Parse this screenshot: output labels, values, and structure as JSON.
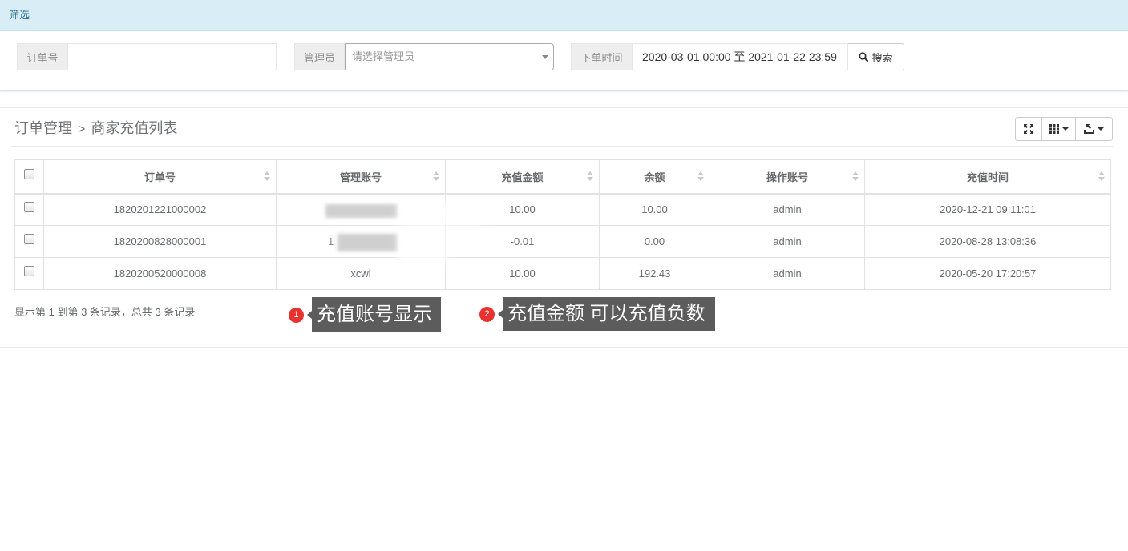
{
  "filter": {
    "title": "筛选",
    "order_no": {
      "label": "订单号",
      "value": ""
    },
    "admin": {
      "label": "管理员",
      "placeholder": "请选择管理员"
    },
    "order_time": {
      "label": "下单时间",
      "value": "2020-03-01 00:00 至 2021-01-22 23:59"
    },
    "search_label": "搜索"
  },
  "list": {
    "breadcrumb": {
      "parent": "订单管理",
      "separator": ">",
      "current": "商家充值列表"
    },
    "table": {
      "columns": [
        "订单号",
        "管理账号",
        "充值金额",
        "余额",
        "操作账号",
        "充值时间"
      ],
      "rows": [
        {
          "order_no": "1820201221000002",
          "account": "",
          "account_redacted": true,
          "amount": "10.00",
          "balance": "10.00",
          "operator": "admin",
          "time": "2020-12-21 09:11:01"
        },
        {
          "order_no": "1820200828000001",
          "account": "1",
          "account_redacted": true,
          "amount": "-0.01",
          "balance": "0.00",
          "operator": "admin",
          "time": "2020-08-28 13:08:36"
        },
        {
          "order_no": "1820200520000008",
          "account": "xcwl",
          "account_redacted": false,
          "amount": "10.00",
          "balance": "192.43",
          "operator": "admin",
          "time": "2020-05-20 17:20:57"
        }
      ]
    },
    "pagination_info": "显示第 1 到第 3 条记录，总共 3 条记录"
  },
  "annotations": [
    {
      "number": "1",
      "text": "充值账号显示"
    },
    {
      "number": "2",
      "text": "充值金额 可以充值负数"
    }
  ],
  "icons": {
    "search": "search-icon",
    "fullscreen": "fullscreen-icon",
    "columns": "columns-icon",
    "export": "export-icon",
    "dropdown": "chevron-down-icon",
    "sort": "sort-icon"
  },
  "colors": {
    "filter_heading_bg": "#d9edf7",
    "filter_heading_text": "#31708f",
    "annotation_badge": "#e8322f",
    "annotation_box": "#5c5c5c",
    "table_text": "#676a6c"
  }
}
